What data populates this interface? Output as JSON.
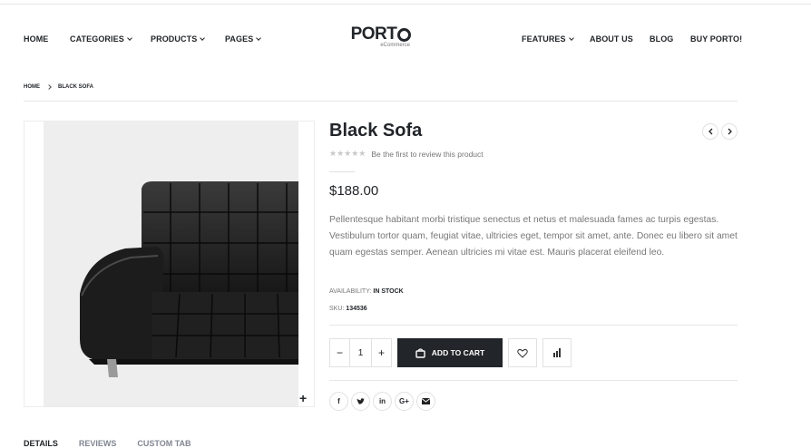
{
  "header": {
    "nav_left": [
      {
        "label": "HOME",
        "has_dropdown": false
      },
      {
        "label": "CATEGORIES",
        "has_dropdown": true
      },
      {
        "label": "PRODUCTS",
        "has_dropdown": true
      },
      {
        "label": "PAGES",
        "has_dropdown": true
      }
    ],
    "nav_right": [
      {
        "label": "FEATURES",
        "has_dropdown": true
      },
      {
        "label": "ABOUT US",
        "has_dropdown": false
      },
      {
        "label": "BLOG",
        "has_dropdown": false
      },
      {
        "label": "BUY PORTO!",
        "has_dropdown": false
      }
    ],
    "logo": {
      "main": "PORT",
      "sub": "eCommerce"
    }
  },
  "breadcrumb": {
    "home": "HOME",
    "current": "BLACK SOFA"
  },
  "product": {
    "title": "Black Sofa",
    "rating_stars": 0,
    "review_text": "Be the first to review this product",
    "price": "$188.00",
    "description": "Pellentesque habitant morbi tristique senectus et netus et malesuada fames ac turpis egestas. Vestibulum tortor quam, feugiat vitae, ultricies eget, tempor sit amet, ante. Donec eu libero sit amet quam egestas semper. Aenean ultricies mi vitae est. Mauris placerat eleifend leo.",
    "availability_label": "AVAILABILITY:",
    "availability_value": "IN STOCK",
    "sku_label": "SKU:",
    "sku_value": "134536",
    "quantity": "1",
    "minus": "−",
    "plus": "+",
    "add_to_cart": "ADD TO CART",
    "zoom": "+"
  },
  "share": [
    "f",
    "t",
    "in",
    "G+",
    "mail"
  ],
  "tabs": [
    {
      "label": "DETAILS",
      "active": true
    },
    {
      "label": "REVIEWS",
      "active": false
    },
    {
      "label": "CUSTOM TAB",
      "active": false
    }
  ],
  "colors": {
    "text_dark": "#222529",
    "muted": "#777777",
    "border": "#e1e1e1",
    "button_bg": "#222529"
  }
}
